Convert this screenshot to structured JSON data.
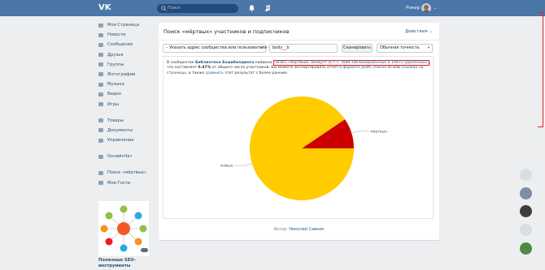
{
  "topbar": {
    "logo": "VK",
    "search_placeholder": "Поиск",
    "user_name": "Рокир",
    "chevron": "⌄"
  },
  "sidebar": {
    "items": [
      {
        "label": "Моя Страница",
        "icon": "home-icon"
      },
      {
        "label": "Новости",
        "icon": "news-icon"
      },
      {
        "label": "Сообщения",
        "icon": "messages-icon"
      },
      {
        "label": "Друзья",
        "icon": "friends-icon"
      },
      {
        "label": "Группы",
        "icon": "groups-icon"
      },
      {
        "label": "Фотографии",
        "icon": "photos-icon"
      },
      {
        "label": "Музыка",
        "icon": "music-icon"
      },
      {
        "label": "Видео",
        "icon": "video-icon"
      },
      {
        "label": "Игры",
        "icon": "games-icon"
      }
    ],
    "items2": [
      {
        "label": "Товары",
        "icon": "goods-icon"
      },
      {
        "label": "Документы",
        "icon": "documents-icon"
      },
      {
        "label": "Управление",
        "icon": "manage-icon"
      }
    ],
    "items3": [
      {
        "label": "ОнлайнЧат",
        "icon": "chat-icon"
      }
    ],
    "items4": [
      {
        "label": "Поиск «мёртвых»",
        "icon": "app-icon"
      },
      {
        "label": "Мои Гости",
        "icon": "app-icon"
      }
    ],
    "promo_title": "Полезные SEO-инструменты"
  },
  "card": {
    "title": "Поиск «мёртвых» участников и подписчиков",
    "actions": "Действия ⌄",
    "controls": {
      "source_select": "– Указать адрес сообщества или пользователя –",
      "source_value": "body__b",
      "scan_button": "Сканировать",
      "precision_select": "Обычная точность"
    },
    "info": {
      "part1": "В сообществе ",
      "community": "Библиотека Бодибилдинга",
      "part2": " найдено ",
      "highlight": "16361 «мёртвый» аккаунт (в т.ч. 1689 заблокированных и 14672 удалённых)",
      "part3": ", что составляет ",
      "percent": "0.47%",
      "part4": " от общего числа участников. Вы можете экспортировать отчет ",
      "export1": "в формате JSON",
      "part5": ", ",
      "export2": "списке ID",
      "part6": " или ",
      "export3": "ссылках на страницы",
      "part7": ", а также ",
      "compare": "сравнить",
      "part8": " этот результат с более ранним."
    },
    "footer_prefix": "Автор: ",
    "footer_author": "Николай Савкин"
  },
  "chart_data": {
    "type": "pie",
    "slices": [
      {
        "label": "мёртвые",
        "value": 0.0947,
        "color": "#cc0000"
      },
      {
        "label": "живые",
        "value": 0.9053,
        "color": "#ffcc00"
      }
    ]
  },
  "colors": {
    "header": "#4a76a8",
    "accent_link": "#2a5885",
    "highlight_border": "#e02525"
  }
}
